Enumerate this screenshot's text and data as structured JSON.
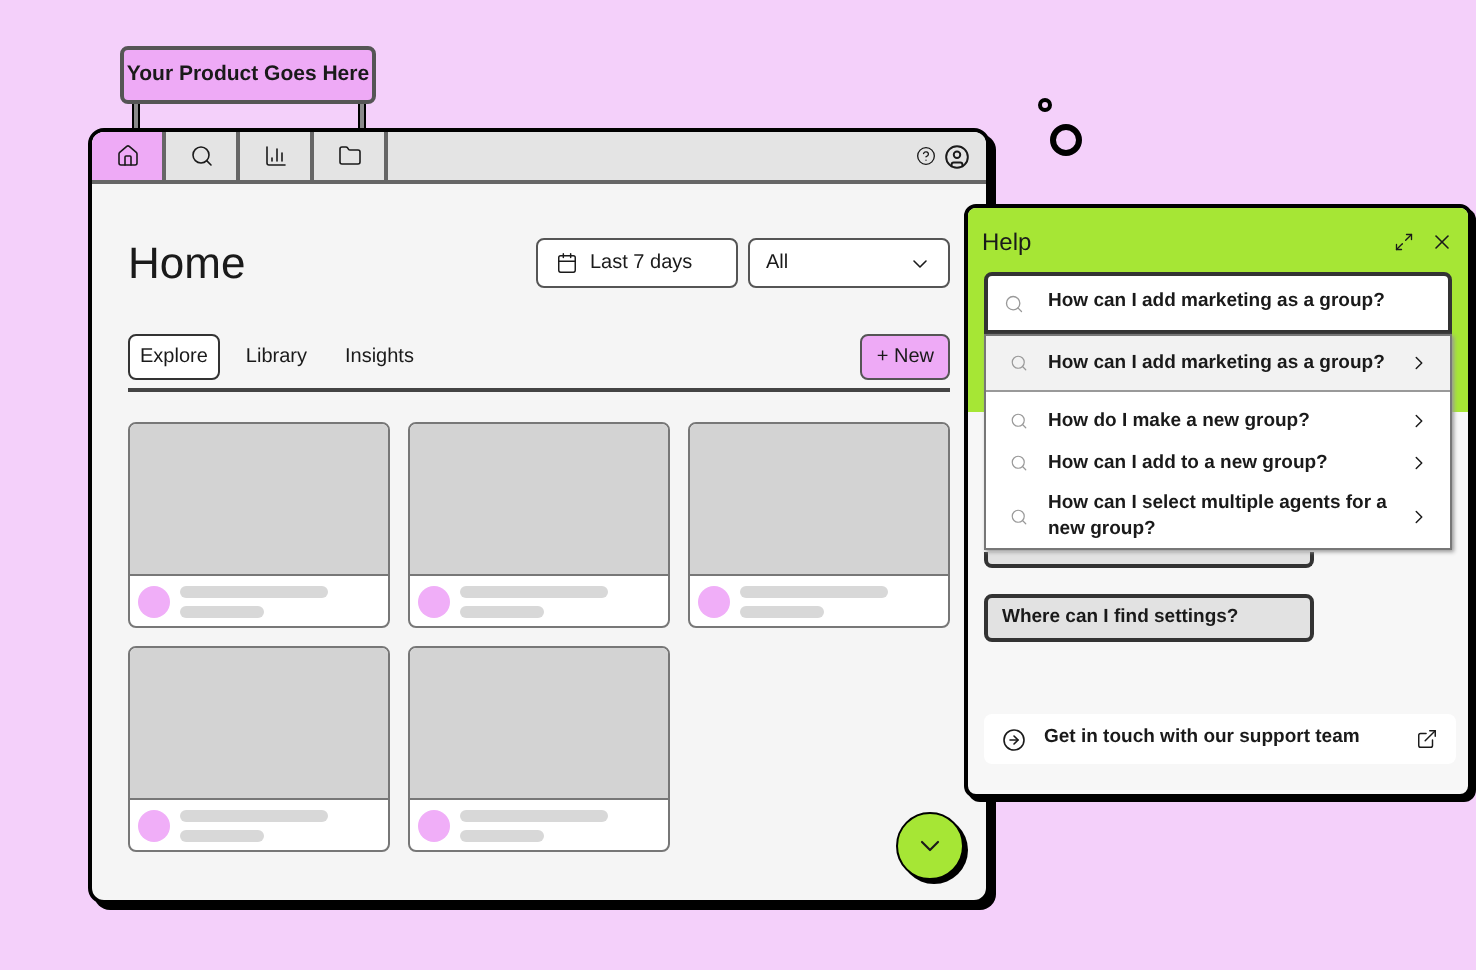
{
  "sign": {
    "text": "Your Product Goes Here"
  },
  "nav_tabs": [
    {
      "kind": "home",
      "selected": true
    },
    {
      "kind": "search",
      "selected": false
    },
    {
      "kind": "chart",
      "selected": false
    },
    {
      "kind": "folder",
      "selected": false
    }
  ],
  "page": {
    "title": "Home",
    "date_filter": "Last 7 days",
    "select": {
      "value": "All"
    },
    "tabs": [
      {
        "label": "Explore",
        "selected": true
      },
      {
        "label": "Library",
        "selected": false
      },
      {
        "label": "Insights",
        "selected": false
      }
    ],
    "new_button": "+ New",
    "cards": [
      {
        "kind": "placeholder"
      },
      {
        "kind": "placeholder"
      },
      {
        "kind": "placeholder"
      },
      {
        "kind": "placeholder"
      },
      {
        "kind": "placeholder"
      }
    ]
  },
  "help": {
    "title": "Help",
    "search": {
      "value": "How can I add marketing as a group?"
    },
    "suggestions": [
      {
        "text": "How can I add marketing as a group?",
        "selected": true
      },
      {
        "text": "How do I make a new group?",
        "selected": false
      },
      {
        "text": "How can I add to a new group?",
        "selected": false
      },
      {
        "text": "How can I select multiple agents for a new group?",
        "selected": false
      }
    ],
    "chips": [
      {
        "covered": true
      },
      {
        "covered": false,
        "text": "Where can I find settings?"
      }
    ],
    "support_link": "Get in touch with our support team"
  }
}
